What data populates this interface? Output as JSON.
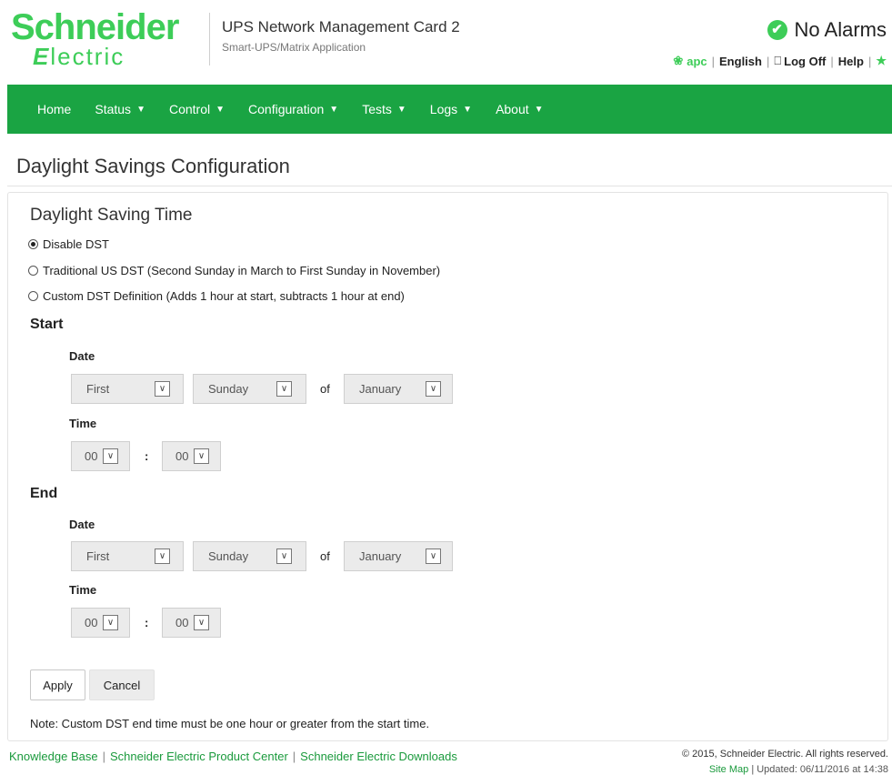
{
  "header": {
    "logo_top": "Schneider",
    "logo_mark": "E",
    "logo_bottom": "lectric",
    "app_title": "UPS Network Management Card 2",
    "app_subtitle": "Smart-UPS/Matrix Application",
    "alarm_status": "No Alarms",
    "util": {
      "apc": "apc",
      "language": "English",
      "logoff": "Log Off",
      "help": "Help"
    }
  },
  "nav": {
    "items": [
      {
        "label": "Home",
        "caret": false
      },
      {
        "label": "Status",
        "caret": true
      },
      {
        "label": "Control",
        "caret": true
      },
      {
        "label": "Configuration",
        "caret": true
      },
      {
        "label": "Tests",
        "caret": true
      },
      {
        "label": "Logs",
        "caret": true
      },
      {
        "label": "About",
        "caret": true
      }
    ]
  },
  "page": {
    "title": "Daylight Savings Configuration",
    "section_title": "Daylight Saving Time",
    "options": [
      {
        "label": "Disable DST",
        "checked": true
      },
      {
        "label": "Traditional US DST (Second Sunday in March to First Sunday in November)",
        "checked": false
      },
      {
        "label": "Custom DST Definition (Adds 1 hour at start, subtracts 1 hour at end)",
        "checked": false
      }
    ],
    "start": {
      "heading": "Start",
      "date_label": "Date",
      "week": "First",
      "day": "Sunday",
      "of_label": "of",
      "month": "January",
      "time_label": "Time",
      "hour": "00",
      "colon": ":",
      "minute": "00"
    },
    "end": {
      "heading": "End",
      "date_label": "Date",
      "week": "First",
      "day": "Sunday",
      "of_label": "of",
      "month": "January",
      "time_label": "Time",
      "hour": "00",
      "colon": ":",
      "minute": "00"
    },
    "apply_label": "Apply",
    "cancel_label": "Cancel",
    "note": "Note: Custom DST end time must be one hour or greater from the start time."
  },
  "footer": {
    "links": [
      "Knowledge Base",
      "Schneider Electric Product Center",
      "Schneider Electric Downloads"
    ],
    "copyright": "© 2015, Schneider Electric. All rights reserved.",
    "sitemap": "Site Map",
    "updated": "Updated: 06/11/2016 at 14:38"
  },
  "colors": {
    "brand_green": "#3dcd58",
    "nav_green": "#1aa443"
  },
  "icons": {
    "alarm": "check-circle-icon",
    "apc": "apc-icon",
    "logoff": "logoff-icon",
    "pin": "pin-icon",
    "select_arrow": "chevron-down-icon",
    "nav_caret": "caret-down-icon"
  }
}
